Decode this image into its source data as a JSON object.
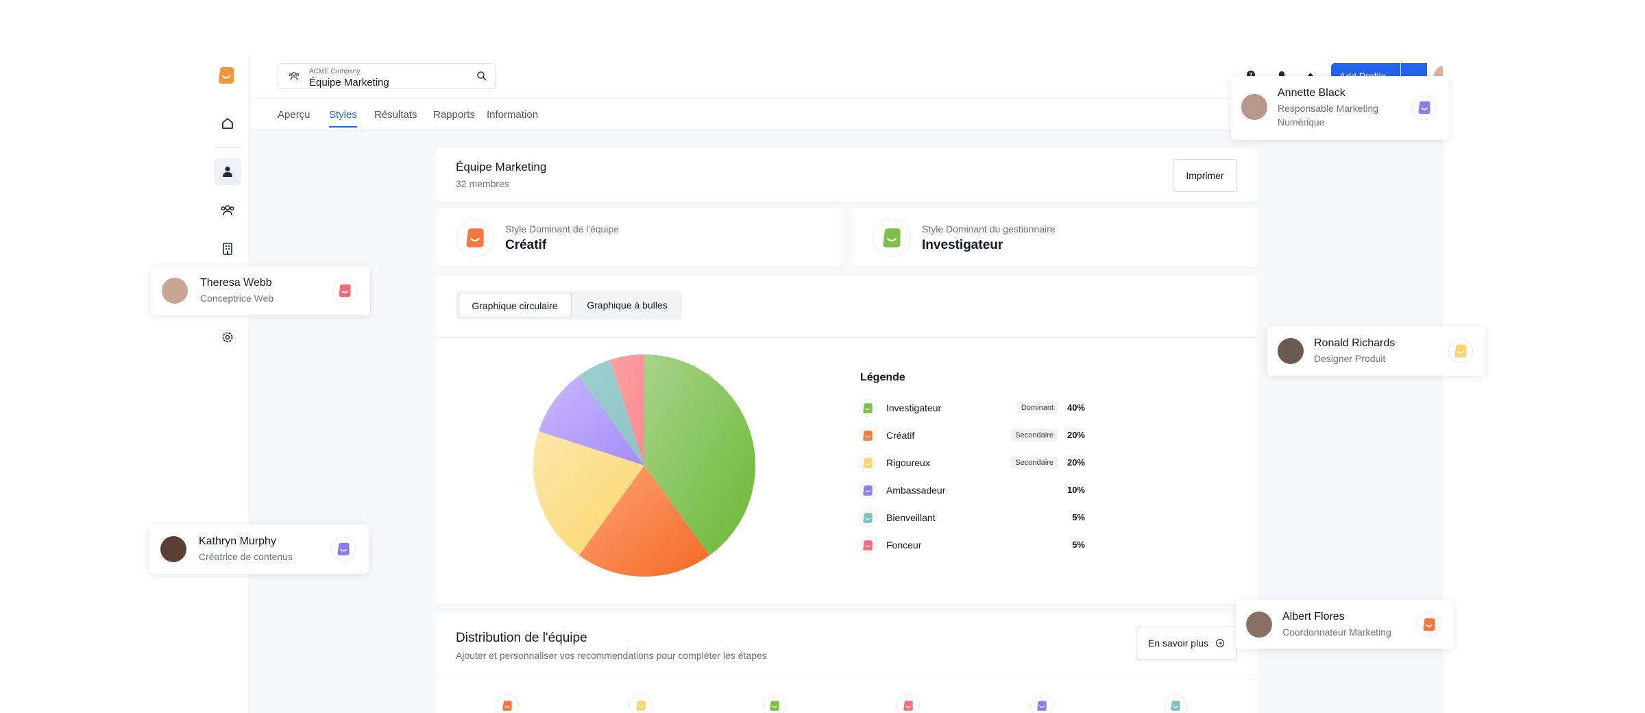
{
  "company": {
    "name": "ACME Company",
    "team": "Équipe Marketing"
  },
  "topbar": {
    "add_label": "Add Profile"
  },
  "tabs": [
    "Aperçu",
    "Styles",
    "Résultats",
    "Rapports",
    "Information"
  ],
  "header": {
    "title": "Équipe Marketing",
    "members": "32 membres",
    "print_label": "Imprimer"
  },
  "dominant": {
    "team_label": "Style Dominant de l'équipe",
    "team_value": "Créatif",
    "manager_label": "Style Dominant du gestionnaire",
    "manager_value": "Investigateur"
  },
  "chart_tabs": {
    "pie": "Graphique circulaire",
    "bubble": "Graphique à bulles"
  },
  "chart_data": {
    "type": "pie",
    "title": "",
    "legend_title": "Légende",
    "legend_position": "right",
    "categories": [
      "Investigateur",
      "Créatif",
      "Rigoureux",
      "Ambassadeur",
      "Bienveillant",
      "Fonceur"
    ],
    "values": [
      40,
      20,
      20,
      10,
      5,
      5
    ],
    "labels": [
      "40%",
      "20%",
      "20%",
      "10%",
      "5%",
      "5%"
    ],
    "badges": [
      "Dominant",
      "Secondaire",
      "Secondaire",
      "",
      "",
      ""
    ],
    "colors": [
      "#7cc04a",
      "#f6783a",
      "#fbd56b",
      "#8b7cf6",
      "#7cc4c4",
      "#f56b7a"
    ]
  },
  "distribution": {
    "title": "Distribution de l'équipe",
    "subtitle": "Ajouter et personnaliser vos recommendations pour compléter les étapes",
    "more_label": "En savoir plus",
    "icon_colors": [
      "#f6783a",
      "#fbd56b",
      "#7cc04a",
      "#f56b7a",
      "#8b7cf6",
      "#7cc4c4"
    ]
  },
  "floats": [
    {
      "name": "Annette Black",
      "role": "Responsable Marketing Numérique",
      "color": "#8b7cf6"
    },
    {
      "name": "Theresa Webb",
      "role": "Conceptrice Web",
      "color": "#f56b7a"
    },
    {
      "name": "Ronald Richards",
      "role": "Designer Produit",
      "color": "#fbd56b"
    },
    {
      "name": "Kathryn Murphy",
      "role": "Créatrice de contenus",
      "color": "#8b7cf6"
    },
    {
      "name": "Albert Flores",
      "role": "Coordonnateur Marketing",
      "color": "#f6783a"
    }
  ]
}
